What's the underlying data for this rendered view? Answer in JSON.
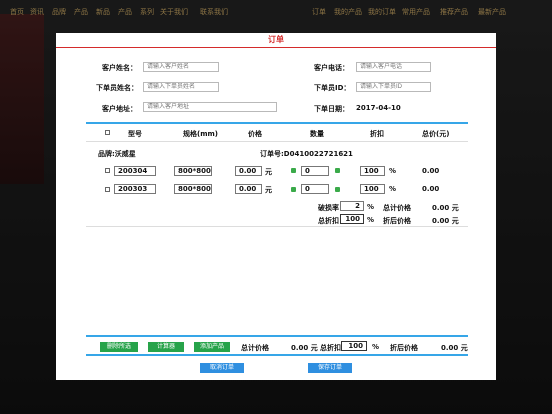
{
  "background_nav": {
    "items": [
      "首页",
      "资讯",
      "品牌",
      "产品",
      "新品",
      "产品",
      "系列",
      "关于我们",
      "联系我们",
      "订单",
      "我的产品",
      "我的订单",
      "常用产品",
      "推荐产品",
      "最新产品"
    ]
  },
  "modal": {
    "title": "订单",
    "accent_color": "#d42b2b",
    "divider_color": "#36a6e8"
  },
  "form": {
    "customer_name": {
      "label": "客户姓名：",
      "placeholder": "请输入客户姓名"
    },
    "customer_phone": {
      "label": "客户电话：",
      "placeholder": "请输入客户电话"
    },
    "orderer_name": {
      "label": "下单员姓名：",
      "placeholder": "请输入下单员姓名"
    },
    "orderer_id": {
      "label": "下单员ID：",
      "placeholder": "请输入下单员ID"
    },
    "customer_address": {
      "label": "客户地址：",
      "placeholder": "请输入客户地址"
    },
    "order_date": {
      "label": "下单日期：",
      "value": "2017-04-10"
    }
  },
  "table": {
    "headers": [
      "型号",
      "规格(mm)",
      "价格",
      "数量",
      "折扣",
      "总价(元)"
    ],
    "brand": "品牌:沃威星",
    "order_no": "订单号:D0410022721621",
    "rows": [
      {
        "model": "200304",
        "spec": "800*800",
        "price": "0.00",
        "price_unit": "元",
        "qty": "0",
        "discount": "100",
        "discount_unit": "%",
        "total": "0.00"
      },
      {
        "model": "200303",
        "spec": "800*800",
        "price": "0.00",
        "price_unit": "元",
        "qty": "0",
        "discount": "100",
        "discount_unit": "%",
        "total": "0.00"
      }
    ],
    "summary": {
      "breakage_label": "破损率",
      "breakage_value": "2",
      "breakage_unit": "%",
      "total_price_label": "总计价格",
      "total_price": "0.00 元",
      "total_discount_label": "总折扣",
      "total_discount_value": "100",
      "total_discount_unit": "%",
      "discounted_label": "折后价格",
      "discounted_price": "0.00 元"
    }
  },
  "footer": {
    "delete_label": "删除所选",
    "calculator_label": "计算器",
    "add_product_label": "添加产品",
    "total_price_label": "总计价格",
    "total_price": "0.00 元",
    "total_discount_label": "总折扣",
    "total_discount_value": "100",
    "total_discount_unit": "%",
    "discounted_label": "折后价格",
    "discounted_price": "0.00 元",
    "cancel_label": "取消订单",
    "save_label": "保存订单"
  }
}
